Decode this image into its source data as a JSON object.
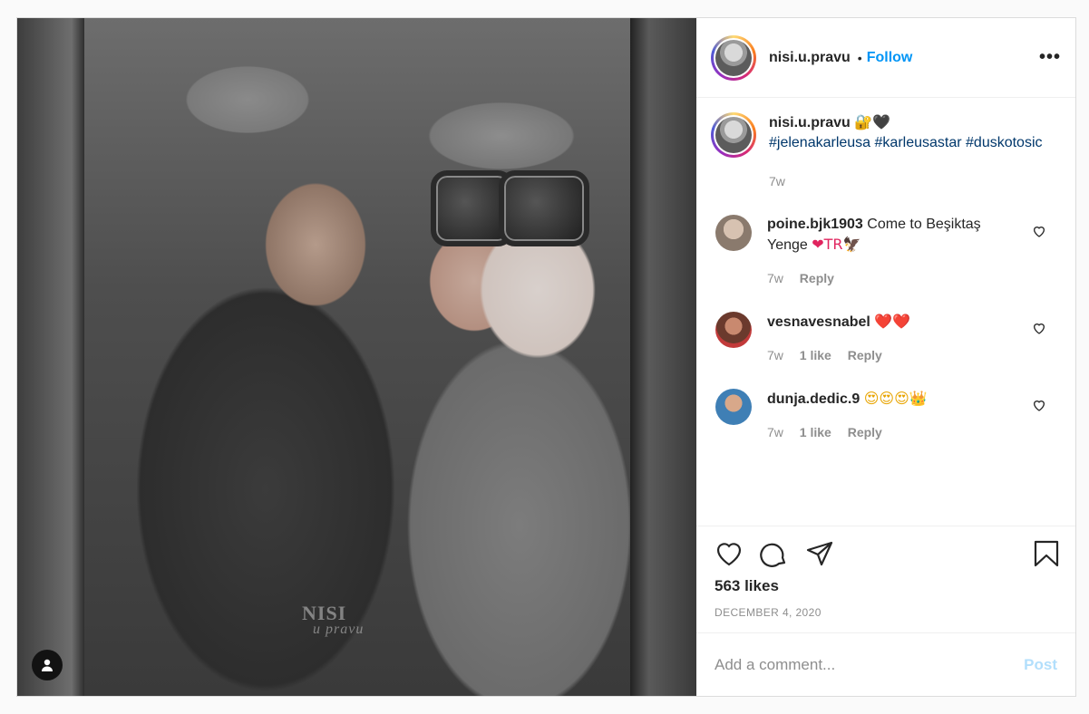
{
  "post": {
    "author": "nisi.u.pravu",
    "follow_label": "Follow",
    "dot": "•",
    "more_label": "•••",
    "watermark_main": "NISI",
    "watermark_sub": "u pravu"
  },
  "caption": {
    "username": "nisi.u.pravu",
    "emoji": "🔐🖤",
    "tags": "#jelenakarleusa #karleusastar #duskotosic",
    "time": "7w"
  },
  "comments": [
    {
      "username": "poine.bjk1903",
      "text": "Come to Beşiktaş Yenge",
      "emoji": "❤TR🦅",
      "time": "7w",
      "likes": "",
      "reply": "Reply",
      "avatar_color": "#cbb8a8"
    },
    {
      "username": "vesnavesnabel",
      "text": "",
      "emoji": "❤️❤️",
      "time": "7w",
      "likes": "1 like",
      "reply": "Reply",
      "avatar_color": "#7a4a3c"
    },
    {
      "username": "dunja.dedic.9",
      "text": "",
      "emoji": "😍😍😍👑",
      "time": "7w",
      "likes": "1 like",
      "reply": "Reply",
      "avatar_color": "#3f7fb5"
    }
  ],
  "stats": {
    "likes": "563 likes",
    "date": "DECEMBER 4, 2020"
  },
  "composer": {
    "placeholder": "Add a comment...",
    "post_label": "Post"
  }
}
